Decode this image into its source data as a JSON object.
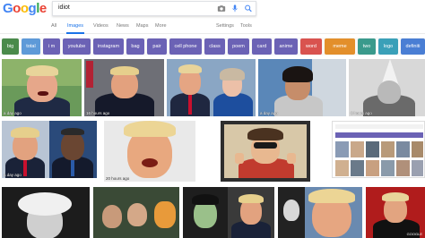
{
  "logo": {
    "letters": [
      "G",
      "o",
      "o",
      "g",
      "l",
      "e"
    ],
    "colors": [
      "#4285f4",
      "#ea4335",
      "#fbbc05",
      "#4285f4",
      "#34a853",
      "#ea4335"
    ]
  },
  "search": {
    "query": "idiot"
  },
  "tabs": {
    "all": "All",
    "images": "Images",
    "videos": "Videos",
    "news": "News",
    "maps": "Maps",
    "more": "More",
    "settings": "Settings",
    "tools": "Tools"
  },
  "chips": [
    {
      "label": "big",
      "color": "#4a8a4b"
    },
    {
      "label": "total",
      "color": "#5e9ad8"
    },
    {
      "label": "i m",
      "color": "#6b62b5"
    },
    {
      "label": "youtube",
      "color": "#6b62b5"
    },
    {
      "label": "instagram",
      "color": "#6b62b5"
    },
    {
      "label": "bag",
      "color": "#6b62b5"
    },
    {
      "label": "pair",
      "color": "#6b62b5"
    },
    {
      "label": "cell phone",
      "color": "#6b62b5"
    },
    {
      "label": "class",
      "color": "#6b62b5"
    },
    {
      "label": "poem",
      "color": "#6b62b5"
    },
    {
      "label": "card",
      "color": "#6b62b5"
    },
    {
      "label": "anime",
      "color": "#6b62b5"
    },
    {
      "label": "word",
      "color": "#d9534f"
    },
    {
      "label": "meme",
      "color": "#e38f2b"
    },
    {
      "label": "two",
      "color": "#3a9a8c"
    },
    {
      "label": "logo",
      "color": "#3aa0b8"
    },
    {
      "label": "definiti",
      "color": "#4a7ed4"
    }
  ],
  "results": {
    "row1": [
      {
        "time": "a day ago"
      },
      {
        "time": "16 hours ago"
      },
      {
        "time": ""
      },
      {
        "time": "a day ago"
      },
      {
        "time": "6 hours ago"
      }
    ],
    "row2": [
      {
        "time": "a day ago"
      },
      {
        "time": "20 hours ago"
      },
      {
        "time": ""
      },
      {
        "time": ""
      }
    ],
    "row3": [
      {
        "time": ""
      },
      {
        "time": ""
      },
      {
        "time": ""
      },
      {
        "time": ""
      },
      {
        "time": ""
      }
    ]
  },
  "watermark": "GOOGLE"
}
